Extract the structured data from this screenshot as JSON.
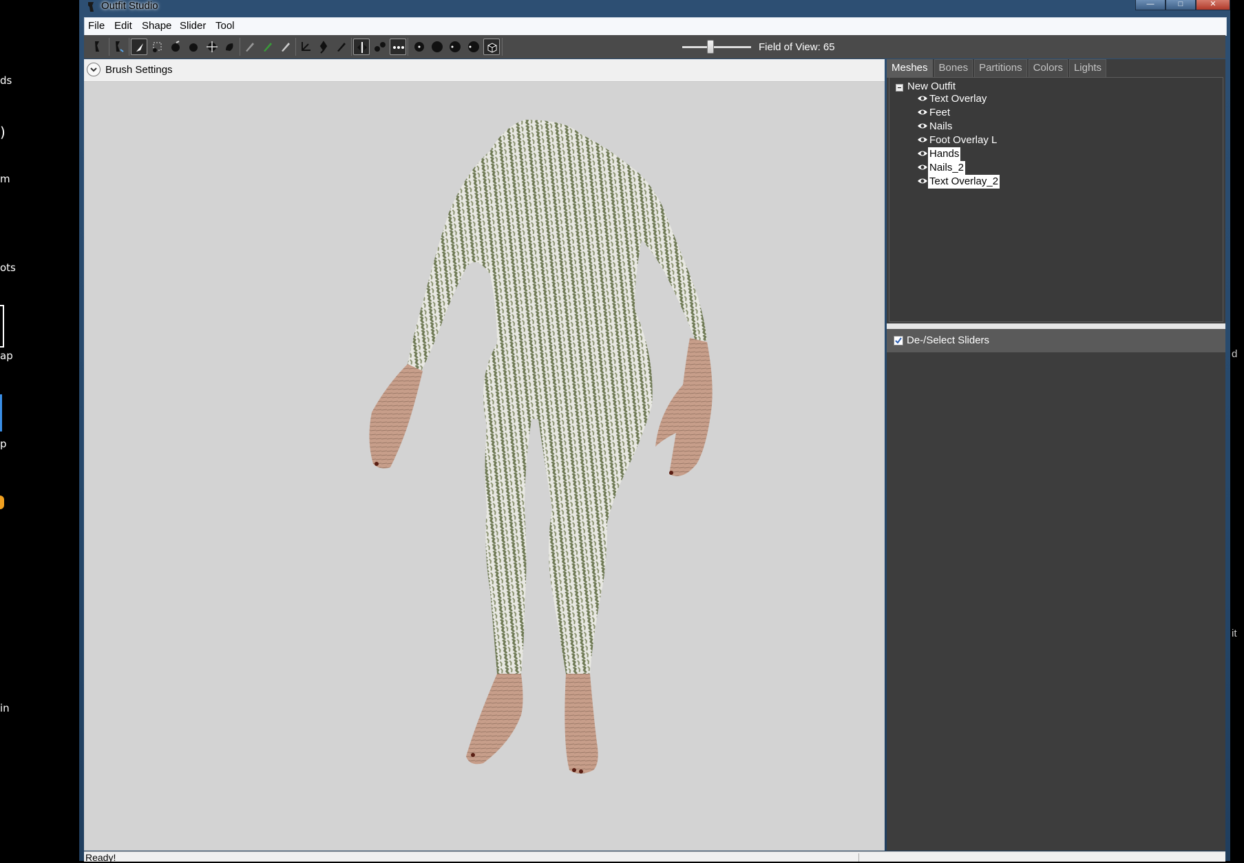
{
  "desktop": {
    "fragments": [
      "ds",
      ")",
      "m",
      "ots",
      "ap",
      "p",
      "in"
    ],
    "right_fragments": [
      "d",
      "it"
    ]
  },
  "window": {
    "title": "Outfit Studio",
    "controls": {
      "minimize": "—",
      "maximize": "□",
      "close": "✕"
    }
  },
  "menubar": {
    "items": [
      "File",
      "Edit",
      "Shape",
      "Slider",
      "Tool"
    ]
  },
  "toolbar": {
    "tools": [
      {
        "icon": "reference-shape-icon"
      },
      {
        "icon": "mirror-shape-icon"
      },
      {
        "icon": "select-tool-icon",
        "active": true
      },
      {
        "icon": "mask-brush-icon"
      },
      {
        "icon": "inflate-brush-icon"
      },
      {
        "icon": "deflate-brush-icon"
      },
      {
        "icon": "move-brush-icon"
      },
      {
        "icon": "smooth-brush-icon"
      },
      {
        "icon": "weight-paint-icon"
      },
      {
        "icon": "color-paint-icon"
      },
      {
        "icon": "alpha-paint-icon"
      },
      {
        "icon": "transform-tool-icon"
      },
      {
        "icon": "pivot-tool-icon"
      },
      {
        "icon": "vertex-edit-icon"
      },
      {
        "icon": "x-mirror-icon",
        "active": true
      },
      {
        "icon": "connected-only-icon"
      },
      {
        "icon": "global-brush-icon",
        "active": true
      },
      {
        "icon": "brush-size-small-icon"
      },
      {
        "icon": "brush-size-medium-icon"
      },
      {
        "icon": "brush-size-large-icon"
      },
      {
        "icon": "brush-size-xlarge-icon"
      },
      {
        "icon": "show-mesh-icon",
        "active": true
      }
    ],
    "fov_label": "Field of View: 65",
    "fov_value": 65
  },
  "viewport": {
    "brush_settings_label": "Brush Settings"
  },
  "panel": {
    "tabs": [
      "Meshes",
      "Bones",
      "Partitions",
      "Colors",
      "Lights"
    ],
    "active_tab": "Meshes",
    "tree_root": "New Outfit",
    "meshes": [
      {
        "label": "Text Overlay",
        "selected": false
      },
      {
        "label": "Feet",
        "selected": false
      },
      {
        "label": "Nails",
        "selected": false
      },
      {
        "label": "Foot Overlay L",
        "selected": false
      },
      {
        "label": "Hands",
        "selected": true
      },
      {
        "label": "Nails_2",
        "selected": true
      },
      {
        "label": "Text Overlay_2",
        "selected": true
      }
    ],
    "sliders_label": "De-/Select Sliders",
    "sliders_checked": true
  },
  "status": {
    "text": "Ready!"
  },
  "colors": {
    "body_green": "#7a8262",
    "skin": "#c79e8a",
    "viewport_bg": "#d3d3d3",
    "panel_bg": "#3d3d3d"
  }
}
